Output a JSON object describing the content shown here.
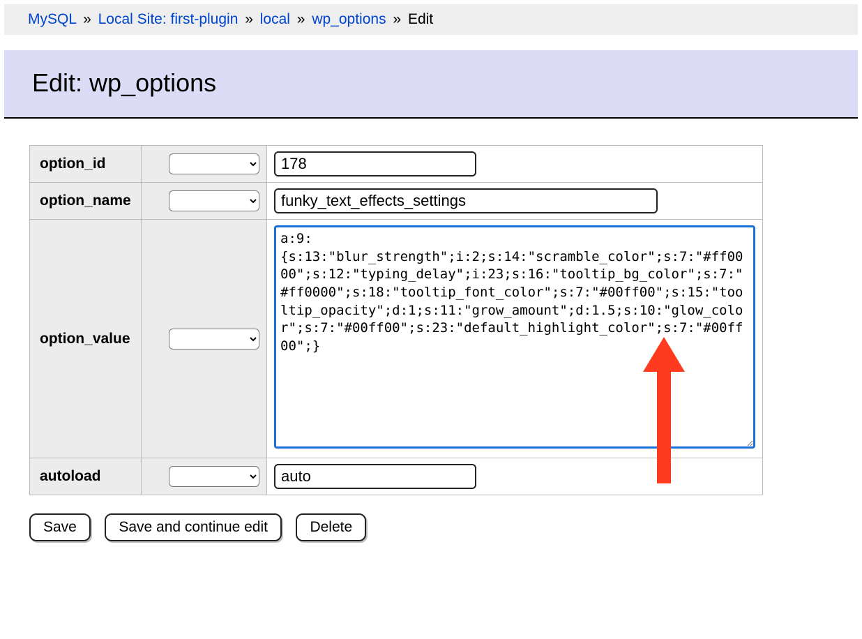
{
  "breadcrumb": {
    "items": [
      {
        "label": "MySQL",
        "link": true
      },
      {
        "label": "Local Site: first-plugin",
        "link": true
      },
      {
        "label": "local",
        "link": true
      },
      {
        "label": "wp_options",
        "link": true
      },
      {
        "label": "Edit",
        "link": false
      }
    ],
    "separator": "»"
  },
  "title": "Edit: wp_options",
  "fields": {
    "option_id": {
      "label": "option_id",
      "value": "178"
    },
    "option_name": {
      "label": "option_name",
      "value": "funky_text_effects_settings"
    },
    "option_value": {
      "label": "option_value",
      "value": "a:9:{s:13:\"blur_strength\";i:2;s:14:\"scramble_color\";s:7:\"#ff0000\";s:12:\"typing_delay\";i:23;s:16:\"tooltip_bg_color\";s:7:\"#ff0000\";s:18:\"tooltip_font_color\";s:7:\"#00ff00\";s:15:\"tooltip_opacity\";d:1;s:11:\"grow_amount\";d:1.5;s:10:\"glow_color\";s:7:\"#00ff00\";s:23:\"default_highlight_color\";s:7:\"#00ff00\";}"
    },
    "autoload": {
      "label": "autoload",
      "value": "auto"
    }
  },
  "buttons": {
    "save": "Save",
    "save_continue": "Save and continue edit",
    "delete": "Delete"
  },
  "annotation": {
    "color": "#ff3b1f"
  }
}
